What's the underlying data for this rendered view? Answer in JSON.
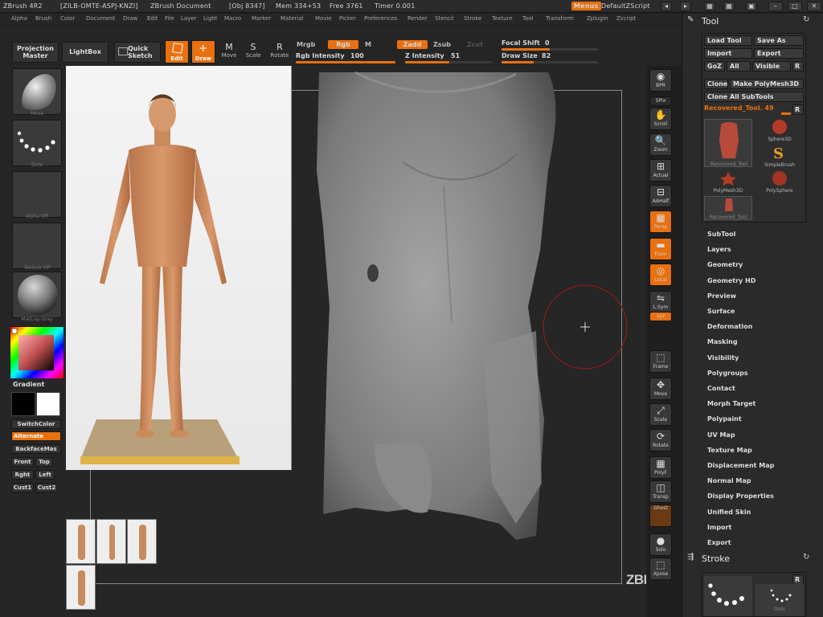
{
  "titlebar": {
    "app": "ZBrush 4R2",
    "build": "[ZILB-OMTE-ASPJ-KNZI]",
    "doc": "ZBrush Document",
    "obj": "[Obj 8347]",
    "mem": "Mem 334+53",
    "free": "Free 3761",
    "timer": "Timer 0.001",
    "menus_label": "Menus",
    "script_label": "DefaultZScript",
    "btn_left": "◂",
    "btn_right": "▸",
    "btn_layout1": "▦",
    "btn_layout2": "▦",
    "btn_lock": "▣",
    "btn_min": "–",
    "btn_max": "□",
    "btn_close": "✕"
  },
  "menubar": {
    "items": [
      "Alpha",
      "Brush",
      "Color",
      "Document",
      "Draw",
      "Edit",
      "File",
      "Layer",
      "Light",
      "Macro",
      "Marker",
      "Material",
      "Movie",
      "Picker",
      "Preferences",
      "Render",
      "Stencil",
      "Stroke",
      "Texture",
      "Tool",
      "Transform",
      "Zplugin",
      "Zscript"
    ]
  },
  "shelf": {
    "projection_master": "Projection Master",
    "lightbox": "LightBox",
    "quick_sketch": "Quick Sketch",
    "edit": "Edit",
    "draw": "Draw",
    "move": "Move",
    "scale": "Scale",
    "rotate": "Rotate",
    "mrgb": "Mrgb",
    "rgb": "Rgb",
    "m": "M",
    "rgb_intensity_label": "Rgb Intensity",
    "rgb_intensity": "100",
    "rgb_intensity_value": 1.0,
    "zadd": "Zadd",
    "zsub": "Zsub",
    "zcut": "Zcut",
    "z_intensity_label": "Z Intensity",
    "z_intensity": "51",
    "z_intensity_value": 0.51,
    "focal_shift_label": "Focal Shift",
    "focal_shift": "0",
    "focal_shift_value": 0.5,
    "draw_size_label": "Draw Size",
    "draw_size": "82",
    "draw_size_value": 0.33
  },
  "lefttray": {
    "brush_caption": "Move",
    "stroke_caption": "Dots",
    "alpha_caption": "Alpha Off",
    "texture_caption": "Texture Off",
    "material_caption": "MatCap Gray",
    "gradient": "Gradient",
    "switchcolor": "SwitchColor",
    "alternate": "Alternate",
    "backfacemask": "BackfaceMas",
    "front": "Front",
    "top": "Top",
    "right": "Rght",
    "left": "Left",
    "cust1": "Cust1",
    "cust2": "Cust2"
  },
  "righttray": {
    "items": [
      {
        "glyph": "◉",
        "label": "BPR"
      },
      {
        "glyph": "",
        "label": "SPix"
      },
      {
        "glyph": "✋",
        "label": "Scroll"
      },
      {
        "glyph": "🔍",
        "label": "Zoom"
      },
      {
        "glyph": "⊞",
        "label": "Actual"
      },
      {
        "glyph": "⊟",
        "label": "AAHalf"
      },
      {
        "glyph": "▦",
        "label": "Persp"
      },
      {
        "glyph": "▬",
        "label": "Floor"
      },
      {
        "glyph": "◎",
        "label": "Local"
      },
      {
        "glyph": "⇋",
        "label": "L.Sym"
      },
      {
        "glyph": "⟲",
        "label": "xyz"
      },
      {
        "glyph": "⬚",
        "label": "Frame"
      },
      {
        "glyph": "✥",
        "label": "Move"
      },
      {
        "glyph": "⤢",
        "label": "Scale"
      },
      {
        "glyph": "⟳",
        "label": "Rotate"
      },
      {
        "glyph": "▦",
        "label": "PolyF"
      },
      {
        "glyph": "◫",
        "label": "Transp"
      },
      {
        "glyph": "",
        "label": "Ghost"
      },
      {
        "glyph": "●",
        "label": "Solo"
      },
      {
        "glyph": "⬚",
        "label": "Xpose"
      }
    ]
  },
  "tool_palette": {
    "title": "Tool",
    "load_tool": "Load Tool",
    "save_as": "Save As",
    "import": "Import",
    "export": "Export",
    "goz": "GoZ",
    "all": "All",
    "visible": "Visible",
    "r": "R",
    "clone": "Clone",
    "make_polymesh": "Make PolyMesh3D",
    "clone_all": "Clone All SubTools",
    "current_tool": "Recovered_Tool. 49",
    "thumbs": [
      {
        "label": "Recovered_Tool"
      },
      {
        "label": "Sphere3D"
      },
      {
        "label": "SimpleBrush"
      },
      {
        "label": "PolyMesh3D"
      },
      {
        "label": "PolySphere"
      },
      {
        "label": "Recovered_Tool"
      }
    ],
    "subpalettes": [
      "SubTool",
      "Layers",
      "Geometry",
      "Geometry HD",
      "Preview",
      "Surface",
      "Deformation",
      "Masking",
      "Visibility",
      "Polygroups",
      "Contact",
      "Morph Target",
      "Polypaint",
      "UV Map",
      "Texture Map",
      "Displacement Map",
      "Normal Map",
      "Display Properties",
      "Unified Skin",
      "Import",
      "Export"
    ],
    "stroke_title": "Stroke",
    "stroke_r": "R",
    "stroke_dots_caption": "Dots"
  },
  "watermark": "ZBRUSH WORKSHOPS",
  "colors": {
    "accent": "#e8700f",
    "panel": "#2a2a2a",
    "canvas": "#262626"
  }
}
